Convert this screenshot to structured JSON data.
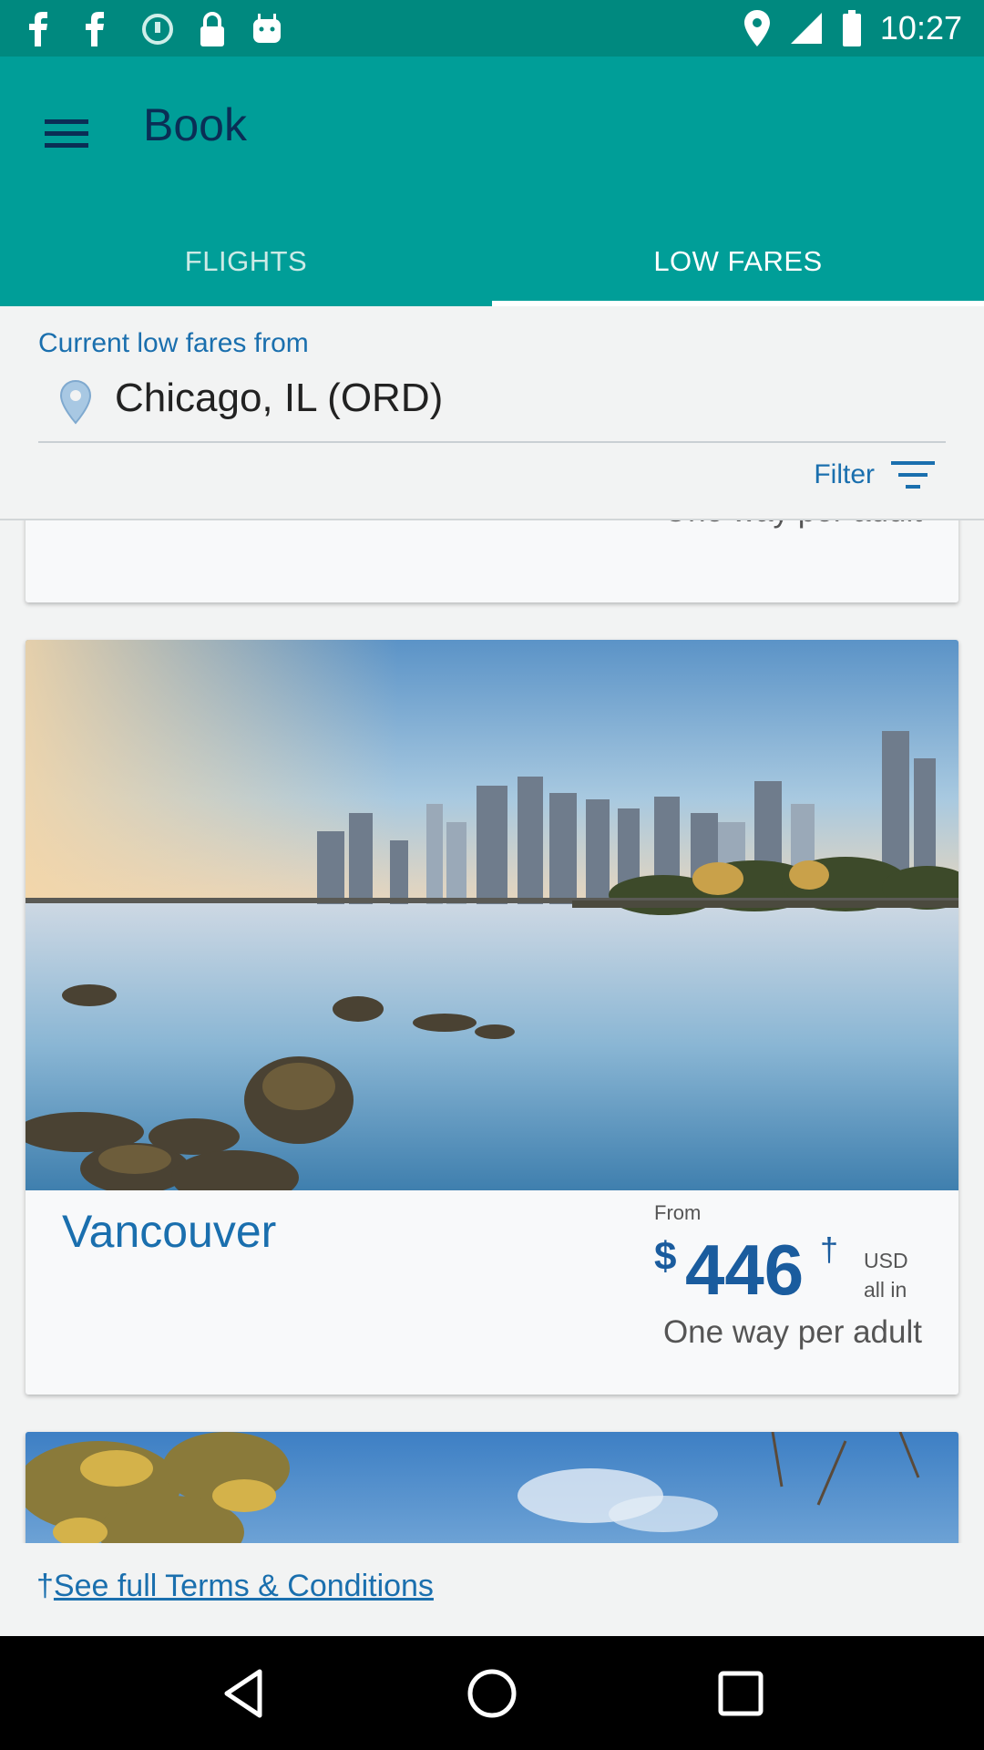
{
  "status_bar": {
    "time": "10:27",
    "left_icons": [
      "facebook-icon",
      "facebook-icon",
      "sync-icon",
      "lock-icon",
      "android-icon"
    ],
    "right_icons": [
      "location-icon",
      "signal-icon",
      "battery-icon"
    ]
  },
  "app_bar": {
    "title": "Book",
    "menu_icon": "menu-icon",
    "background": "#009e98"
  },
  "tabs": [
    {
      "label": "FLIGHTS",
      "selected": false
    },
    {
      "label": "LOW FARES",
      "selected": true
    }
  ],
  "origin": {
    "label": "Current low fares from",
    "value": "Chicago, IL (ORD)",
    "icon": "location-pin-icon"
  },
  "filter": {
    "label": "Filter",
    "icon": "filter-icon"
  },
  "fares": [
    {
      "partial": true,
      "note": "One way per adult"
    },
    {
      "city": "Vancouver",
      "from_label": "From",
      "currency_symbol": "$",
      "price": "446",
      "dagger": "†",
      "currency": "USD",
      "all_in": "all in",
      "note": "One way per adult"
    }
  ],
  "footer": {
    "dagger": "†",
    "terms_label": "See full Terms & Conditions"
  },
  "nav_bar": {
    "buttons": [
      "back-icon",
      "home-icon",
      "recents-icon"
    ]
  },
  "colors": {
    "accent": "#1a6fae",
    "price": "#1a5c9e",
    "status_bar": "#00897f"
  }
}
